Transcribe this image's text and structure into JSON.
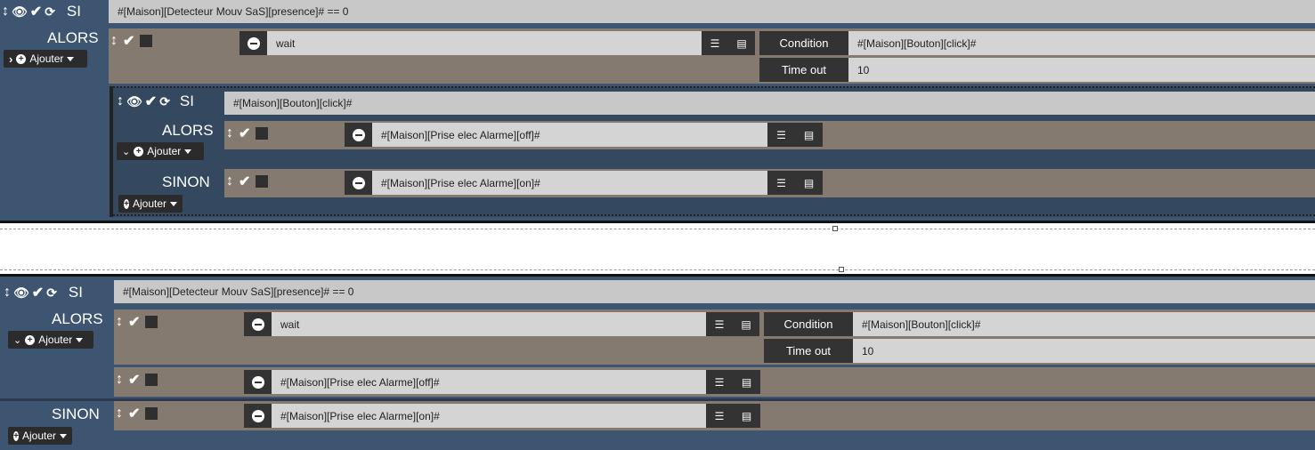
{
  "block1": {
    "si_label": "SI",
    "si_condition": "#[Maison][Detecteur Mouv SaS][presence]# == 0",
    "alors_label": "ALORS",
    "ajouter_label": "Ajouter",
    "wait_action": "wait",
    "condition_key": "Condition",
    "condition_value": "#[Maison][Bouton][click]#",
    "timeout_key": "Time out",
    "timeout_value": "10",
    "nested": {
      "si_label": "SI",
      "si_condition": "#[Maison][Bouton][click]#",
      "alors_label": "ALORS",
      "alors_action": "#[Maison][Prise elec Alarme][off]#",
      "sinon_label": "SINON",
      "sinon_action": "#[Maison][Prise elec Alarme][on]#",
      "ajouter_label": "Ajouter"
    }
  },
  "block2": {
    "si_label": "SI",
    "si_condition": "#[Maison][Detecteur Mouv SaS][presence]# == 0",
    "alors_label": "ALORS",
    "ajouter_label": "Ajouter",
    "wait_action": "wait",
    "condition_key": "Condition",
    "condition_value": "#[Maison][Bouton][click]#",
    "timeout_key": "Time out",
    "timeout_value": "10",
    "action_off": "#[Maison][Prise elec Alarme][off]#",
    "sinon_label": "SINON",
    "action_on": "#[Maison][Prise elec Alarme][on]#",
    "sinon_ajouter_label": "Ajouter"
  },
  "icons": [
    "move-icon",
    "eye-icon",
    "check-icon",
    "refresh-icon",
    "minus-circle-icon",
    "tasks-icon",
    "list-icon",
    "plus-circle-icon",
    "caret-down-icon",
    "chevron-right-icon",
    "chevron-down-icon"
  ]
}
